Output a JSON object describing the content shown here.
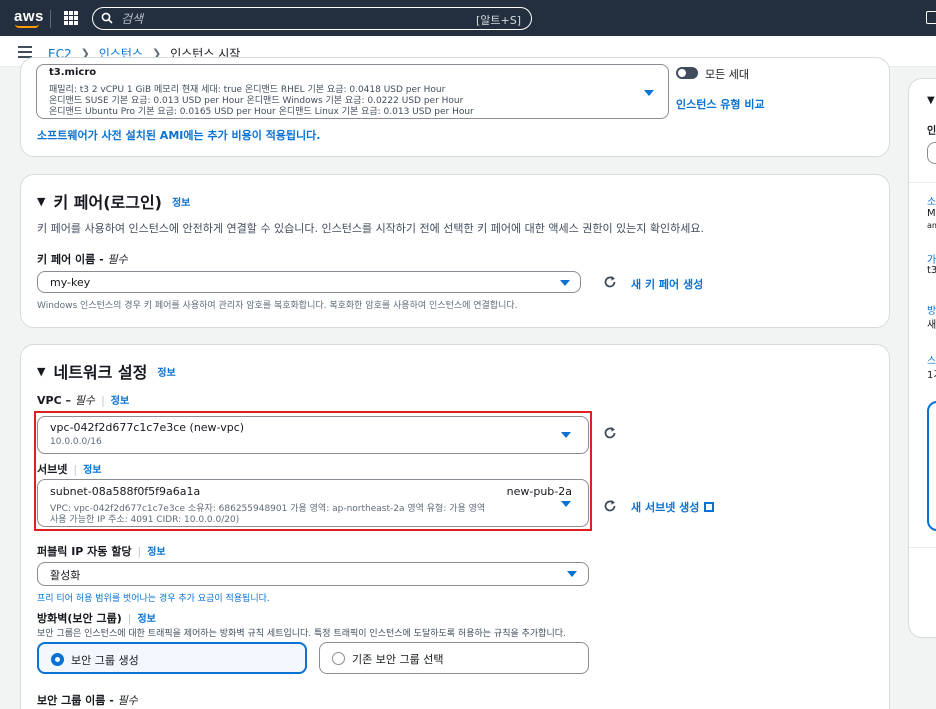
{
  "topbar": {
    "logo": "aws",
    "search_placeholder": "검색",
    "search_shortcut": "[알트+S]"
  },
  "breadcrumb": {
    "items": [
      "EC2",
      "인스턴스"
    ],
    "current": "인스턴스 시작"
  },
  "instance_type": {
    "name": "t3.micro",
    "line1": "패밀리: t3    2 vCPU    1 GiB 메모리    현재 세대: true        온디맨드 RHEL 기본 요금: 0.0418 USD per Hour",
    "line2": "온디맨드 SUSE 기본 요금: 0.013 USD per Hour    온디맨드 Windows 기본 요금: 0.0222 USD per Hour",
    "line3": "온디맨드 Ubuntu Pro 기본 요금: 0.0165 USD per Hour    온디맨드 Linux 기본 요금: 0.013 USD per Hour",
    "all_generations": "모든 세대",
    "compare_link": "인스턴스 유형 비교",
    "ami_note": "소프트웨어가 사전 설치된 AMI에는 추가 비용이 적용됩니다."
  },
  "keypair": {
    "title": "키 페어(로그인)",
    "info": "정보",
    "description": "키 페어를 사용하여 인스턴스에 안전하게 연결할 수 있습니다. 인스턴스를 시작하기 전에 선택한 키 페어에 대한 액세스 권한이 있는지 확인하세요.",
    "label": "키 페어 이름 - ",
    "label_required": "필수",
    "value": "my-key",
    "new_link": "새 키 페어 생성",
    "hint": "Windows 인스턴스의 경우 키 페어를 사용하여 관리자 암호를 복호화합니다. 복호화한 암호를 사용하여 인스턴스에 연결합니다."
  },
  "network": {
    "title": "네트워크 설정",
    "info": "정보",
    "vpc_label": "VPC – ",
    "vpc_required": "필수",
    "vpc_info": "정보",
    "vpc_value": "vpc-042f2d677c1c7e3ce (new-vpc)",
    "vpc_cidr": "10.0.0.0/16",
    "subnet_label": "서브넷",
    "subnet_info": "정보",
    "subnet_id": "subnet-08a588f0f5f9a6a1a",
    "subnet_name": "new-pub-2a",
    "subnet_detail1": "VPC: vpc-042f2d677c1c7e3ce    소유자: 686255948901    가용 영역: ap-northeast-2a    영역 유형: 가용 영역",
    "subnet_detail2": "사용 가능한 IP 주소: 4091    CIDR: 10.0.0.0/20)",
    "new_subnet_link": "새 서브넷 생성",
    "public_ip_label": "퍼블릭 IP 자동 할당",
    "public_ip_info": "정보",
    "public_ip_value": "활성화",
    "free_tier_note": "프리 티어 허용 범위를 벗어나는 경우 추가 요금이 적용됩니다.",
    "firewall_label": "방화벽(보안 그룹)",
    "firewall_info": "정보",
    "firewall_desc": "보안 그룹은 인스턴스에 대한 트래픽을 제어하는 방화벽 규칙 세트입니다. 특정 트래픽이 인스턴스에 도달하도록 허용하는 규칙을 추가합니다.",
    "create_sg": "보안 그룹 생성",
    "existing_sg": "기존 보안 그룹 선택",
    "sg_name_label": "보안 그룹 이름 - ",
    "sg_name_required": "필수"
  },
  "side": {
    "t1": "▼",
    "t2": "인",
    "t3": "소",
    "t4": "M",
    "t5": "am",
    "t6": "가",
    "t7": "t3",
    "t8": "방",
    "t9": "새",
    "t10": "스",
    "t11": "1가"
  },
  "colors": {
    "topbar": "#232f3e",
    "accent": "#0972d3",
    "highlight": "#e02020",
    "logo_smile": "#ff9900"
  }
}
